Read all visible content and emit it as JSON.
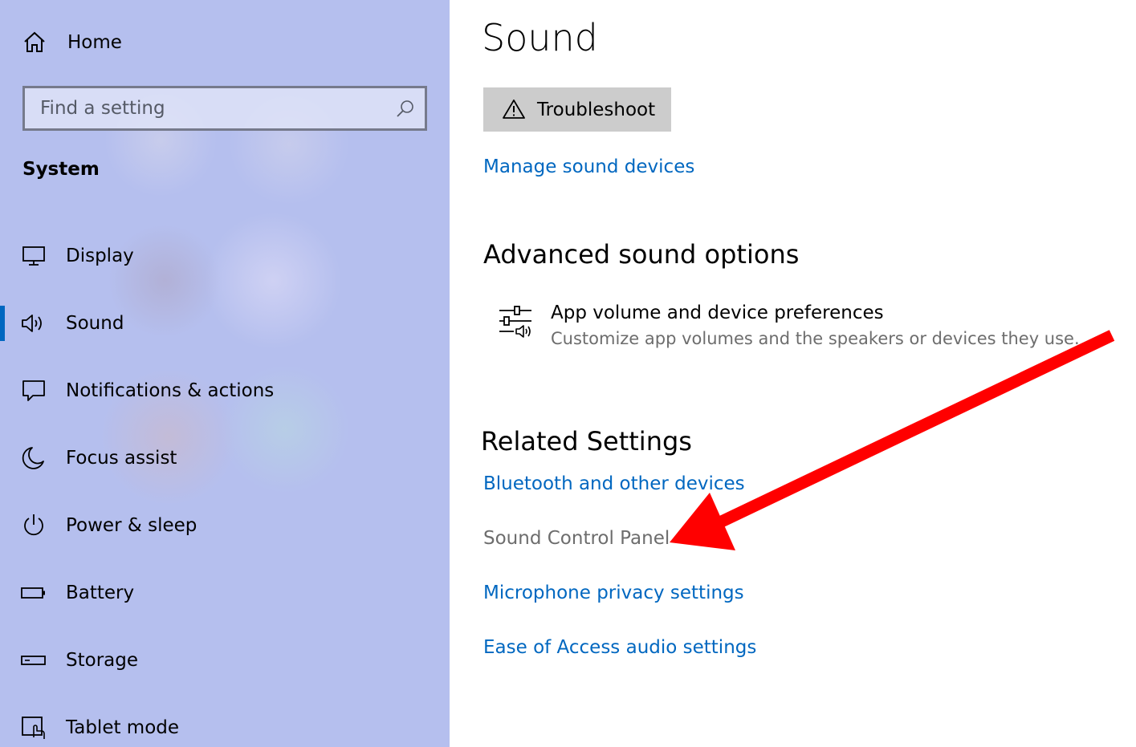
{
  "sidebar": {
    "home_label": "Home",
    "search_placeholder": "Find a setting",
    "section_title": "System",
    "items": [
      {
        "label": "Display",
        "icon": "monitor-icon"
      },
      {
        "label": "Sound",
        "icon": "speaker-icon",
        "selected": true
      },
      {
        "label": "Notifications & actions",
        "icon": "notification-icon"
      },
      {
        "label": "Focus assist",
        "icon": "moon-icon"
      },
      {
        "label": "Power & sleep",
        "icon": "power-icon"
      },
      {
        "label": "Battery",
        "icon": "battery-icon"
      },
      {
        "label": "Storage",
        "icon": "storage-icon"
      },
      {
        "label": "Tablet mode",
        "icon": "tablet-mode-icon"
      }
    ]
  },
  "main": {
    "title": "Sound",
    "troubleshoot_label": "Troubleshoot",
    "manage_devices_link": "Manage sound devices",
    "advanced": {
      "heading": "Advanced sound options",
      "app_volume": {
        "title": "App volume and device preferences",
        "description": "Customize app volumes and the speakers or devices they use."
      }
    },
    "related": {
      "heading": "Related Settings",
      "links": [
        {
          "label": "Bluetooth and other devices"
        },
        {
          "label": "Sound Control Panel",
          "disabled": true
        },
        {
          "label": "Microphone privacy settings"
        },
        {
          "label": "Ease of Access audio settings"
        }
      ]
    }
  },
  "colors": {
    "sidebar_bg": "#b5bfee",
    "accent": "#0067c0",
    "link": "#0067c0",
    "muted_text": "#6d6d6d",
    "button_bg": "#cccccc",
    "annotation_arrow": "#ff0000"
  }
}
